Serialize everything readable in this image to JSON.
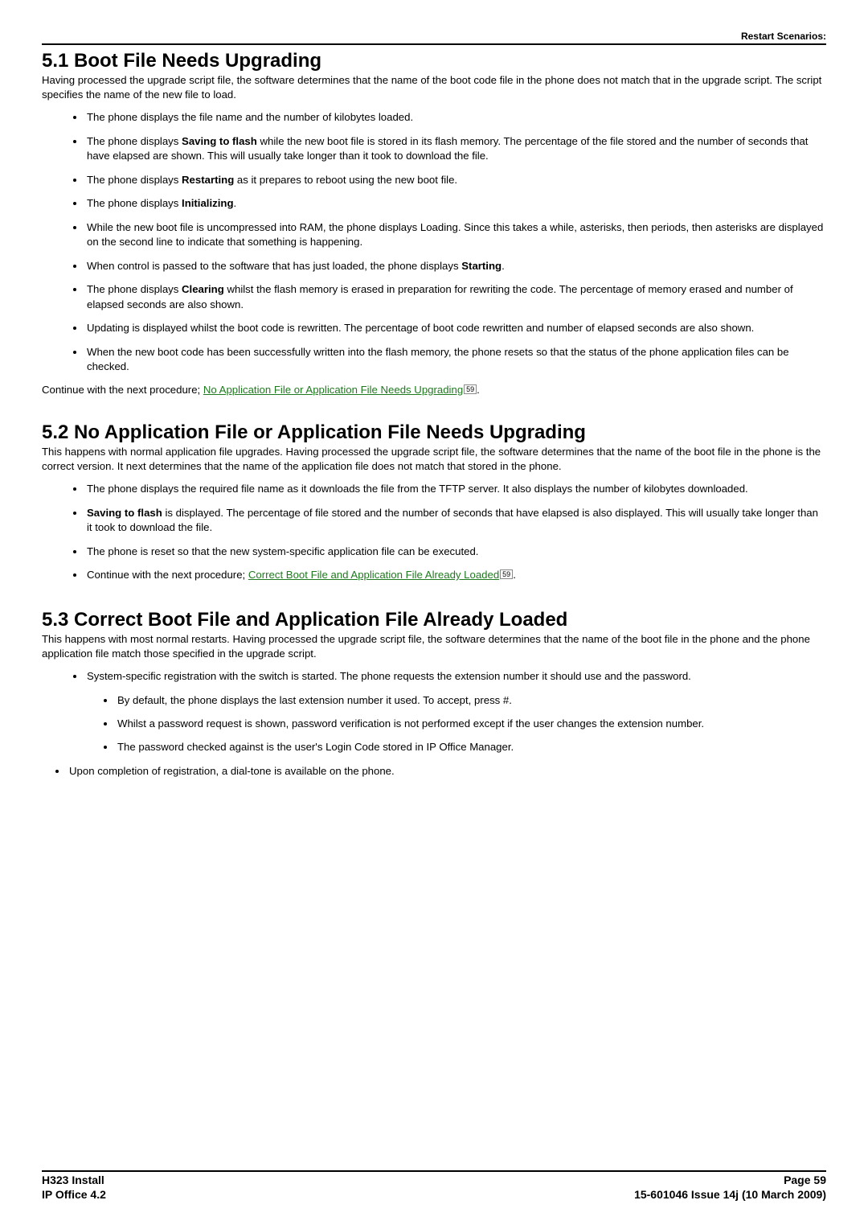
{
  "header": {
    "breadcrumb": "Restart Scenarios:"
  },
  "section1": {
    "title": "5.1 Boot File Needs Upgrading",
    "intro": "Having processed the upgrade script file, the software determines that the name of the boot code file in the phone does not match that in the upgrade script. The script specifies the name of the new file to load.",
    "bullets": [
      {
        "text": "The phone displays the file name and the number of kilobytes loaded."
      },
      {
        "pre": "The phone displays ",
        "bold": "Saving to flash",
        "post": " while the new boot file is stored in its flash memory. The percentage of the file stored and the number of seconds that have elapsed are shown. This will usually take longer than it took to download the file."
      },
      {
        "pre": "The phone displays ",
        "bold": "Restarting",
        "post": " as it prepares to reboot using the new boot file."
      },
      {
        "pre": "The phone displays ",
        "bold": "Initializing",
        "post": "."
      },
      {
        "text": "While the new boot file is uncompressed into RAM, the phone displays Loading. Since this takes a while, asterisks, then periods, then asterisks are displayed on the second line to indicate that something is happening."
      },
      {
        "pre": "When control is passed to the software that has just loaded, the phone displays ",
        "bold": "Starting",
        "post": "."
      },
      {
        "pre": "The phone displays ",
        "bold": "Clearing",
        "post": " whilst the flash memory is erased in preparation for rewriting the code. The percentage of memory erased and number of elapsed seconds are also shown."
      },
      {
        "text": "Updating is displayed whilst the boot code is rewritten. The percentage of boot code rewritten and number of elapsed seconds are also shown."
      },
      {
        "text": "When the new boot code has been successfully written into the flash memory, the phone resets so that the status of the phone application files can be checked."
      }
    ],
    "continue_pre": "Continue with the next procedure; ",
    "continue_link": "No Application File or Application File Needs Upgrading",
    "continue_ref": "59",
    "continue_post": "."
  },
  "section2": {
    "title": "5.2 No Application File or Application File Needs Upgrading",
    "intro": "This happens with normal application file upgrades. Having processed the upgrade script file, the software determines that the name of the boot file in the phone is the correct version. It next determines that the name of the application file does not match that stored in the phone.",
    "bullets": [
      {
        "text": "The phone displays the required file name as it downloads the file from the TFTP server. It also displays the number of kilobytes downloaded."
      },
      {
        "bold": "Saving to flash",
        "post": " is displayed. The percentage of file stored and the number of seconds that have elapsed is also displayed. This will usually take longer than it took to download the file."
      },
      {
        "text": "The phone is reset so that the new system-specific application file can be executed."
      },
      {
        "pre": "Continue with the next procedure; ",
        "link": "Correct Boot File and Application File Already Loaded",
        "ref": "59",
        "post": "."
      }
    ]
  },
  "section3": {
    "title": "5.3 Correct Boot File and Application File Already Loaded",
    "intro": "This happens with most normal restarts. Having processed the upgrade script file, the software determines that the name of the boot file in the phone and the phone application file match those specified in the upgrade script.",
    "bullets": [
      {
        "text": "System-specific registration with the switch is started. The phone requests the extension number it should use and the password.",
        "sub": [
          {
            "text": "By default, the phone displays the last extension number it used. To accept, press #."
          },
          {
            "text": "Whilst a password request is shown, password verification is not performed except if the user changes the extension number."
          },
          {
            "text": "The password checked against is the user's Login Code stored in IP Office Manager."
          }
        ]
      }
    ],
    "bullet_end": "Upon completion of registration, a dial-tone is available on the phone."
  },
  "footer": {
    "left1": "H323 Install",
    "left2": "IP Office 4.2",
    "right1": "Page 59",
    "right2": "15-601046 Issue 14j (10 March 2009)"
  }
}
